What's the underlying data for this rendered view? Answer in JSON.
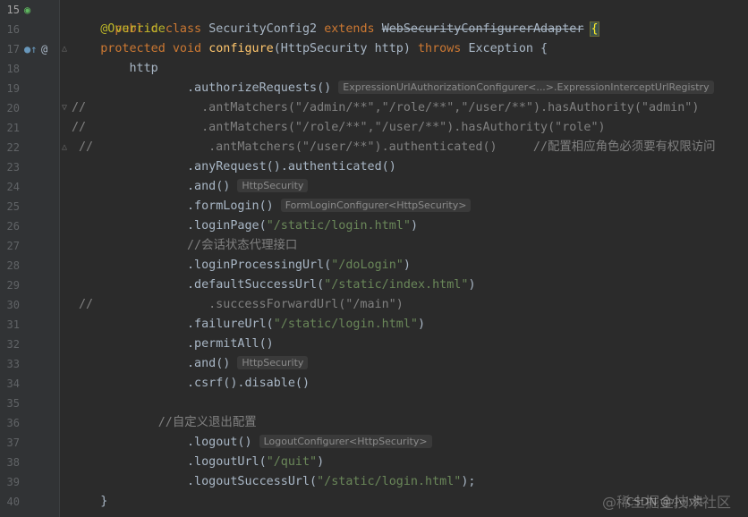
{
  "gutter": {
    "line_numbers": [
      "15",
      "16",
      "17",
      "18",
      "19",
      "20",
      "21",
      "22",
      "23",
      "24",
      "25",
      "26",
      "27",
      "28",
      "29",
      "30",
      "31",
      "32",
      "33",
      "34",
      "35",
      "36",
      "37",
      "38",
      "39",
      "40"
    ],
    "icons": [
      "run-class-icon",
      "override-method-icon",
      "annotation-marker-icon",
      "fold-marker-icon"
    ]
  },
  "code": {
    "l15_public": "public",
    "l15_class": "class",
    "l15_name": "SecurityConfig2",
    "l15_extends": "extends",
    "l15_parent": "WebSecurityConfigurerAdapter",
    "l15_brace": "{",
    "l16_override": "@Override",
    "l17_protected": "protected",
    "l17_void": "void",
    "l17_method": "configure",
    "l17_params": "(HttpSecurity http)",
    "l17_throws": "throws",
    "l17_exception": "Exception {",
    "l18": "http",
    "l19": ".authorizeRequests()",
    "l19_hint": "ExpressionUrlAuthorizationConfigurer<...>.ExpressionInterceptUrlRegistry",
    "l20": "//                .antMatchers(\"/admin/**\",\"/role/**\",\"/user/**\").hasAuthority(\"admin\")",
    "l21": "//                .antMatchers(\"/role/**\",\"/user/**\").hasAuthority(\"role\")",
    "l22": "//                .antMatchers(\"/user/**\").authenticated()     //配置相应角色必须要有权限访问",
    "l23": ".anyRequest().authenticated()",
    "l24": ".and()",
    "l24_hint": "HttpSecurity",
    "l25": ".formLogin()",
    "l25_hint": "FormLoginConfigurer<HttpSecurity>",
    "l26_a": ".loginPage(",
    "l26_s": "\"/static/login.html\"",
    "l26_b": ")",
    "l27": "//会话状态代理接口",
    "l28_a": ".loginProcessingUrl(",
    "l28_s": "\"/doLogin\"",
    "l28_b": ")",
    "l29_a": ".defaultSuccessUrl(",
    "l29_s": "\"/static/index.html\"",
    "l29_b": ")",
    "l30": "//                .successForwardUrl(\"/main\")",
    "l31_a": ".failureUrl(",
    "l31_s": "\"/static/login.html\"",
    "l31_b": ")",
    "l32": ".permitAll()",
    "l33": ".and()",
    "l33_hint": "HttpSecurity",
    "l34": ".csrf().disable()",
    "l36": "//自定义退出配置",
    "l37": ".logout()",
    "l37_hint": "LogoutConfigurer<HttpSecurity>",
    "l38_a": ".logoutUrl(",
    "l38_s": "\"/quit\"",
    "l38_b": ")",
    "l39_a": ".logoutSuccessUrl(",
    "l39_s": "\"/static/login.html\"",
    "l39_b": ");",
    "l40": "}"
  },
  "watermarks": {
    "csdn": "CSDN @小小洪",
    "juejin": "@稀土掘金技术社区"
  },
  "colors": {
    "background": "#2b2b2b",
    "keyword": "#cc7832",
    "annotation": "#bbb529",
    "method_decl": "#ffc66d",
    "string": "#6a8759",
    "comment": "#808080",
    "plain": "#a9b7c6"
  }
}
